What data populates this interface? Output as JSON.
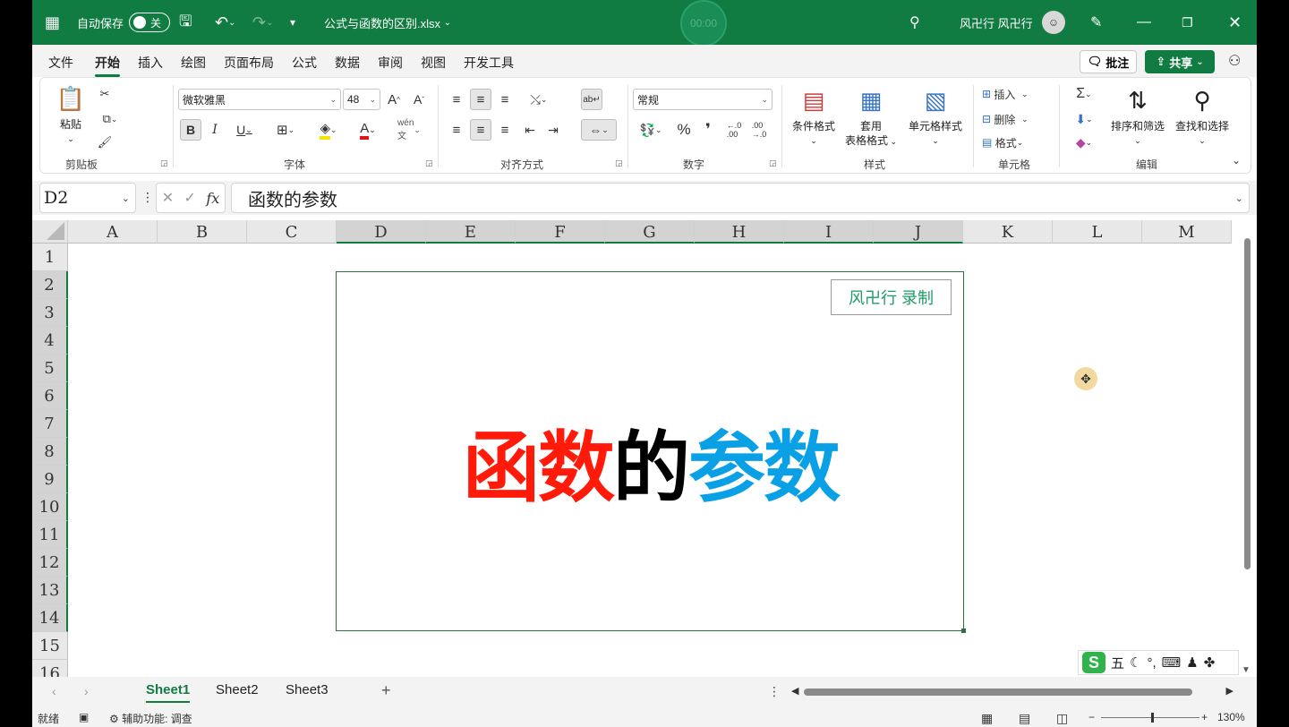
{
  "titlebar": {
    "autosave_label": "自动保存",
    "autosave_state": "关",
    "filename": "公式与函数的区别.xlsx",
    "timer": "00:00",
    "user": "风卍行 风卍行"
  },
  "tabs": [
    "文件",
    "开始",
    "插入",
    "绘图",
    "页面布局",
    "公式",
    "数据",
    "审阅",
    "视图",
    "开发工具"
  ],
  "active_tab": "开始",
  "comment_label": "批注",
  "share_label": "共享",
  "ribbon": {
    "clipboard": {
      "paste": "粘贴",
      "group": "剪贴板"
    },
    "font": {
      "name": "微软雅黑",
      "size": "48",
      "group": "字体"
    },
    "alignment": {
      "group": "对齐方式"
    },
    "number": {
      "format": "常规",
      "group": "数字"
    },
    "styles": {
      "conditional": "条件格式",
      "table_a": "套用",
      "table_b": "表格格式",
      "cell_styles": "单元格样式",
      "group": "样式"
    },
    "cells": {
      "insert": "插入",
      "delete": "删除",
      "format": "格式",
      "group": "单元格"
    },
    "editing": {
      "sort": "排序和筛选",
      "find": "查找和选择",
      "group": "编辑"
    }
  },
  "formula_bar": {
    "name_box": "D2",
    "content": "函数的参数"
  },
  "columns": [
    "A",
    "B",
    "C",
    "D",
    "E",
    "F",
    "G",
    "H",
    "I",
    "J",
    "K",
    "L",
    "M"
  ],
  "selected_columns": [
    "D",
    "E",
    "F",
    "G",
    "H",
    "I",
    "J"
  ],
  "rows": [
    "1",
    "2",
    "3",
    "4",
    "5",
    "6",
    "7",
    "8",
    "9",
    "10",
    "11",
    "12",
    "13",
    "14",
    "15",
    "16"
  ],
  "selected_rows": [
    "2",
    "3",
    "4",
    "5",
    "6",
    "7",
    "8",
    "9",
    "10",
    "11",
    "12",
    "13",
    "14"
  ],
  "shape": {
    "watermark": "风卍行 录制",
    "title_red": "函数",
    "title_black": "的",
    "title_blue": "参数",
    "colors": {
      "red": "#ff1a0a",
      "black": "#000000",
      "blue": "#0aa0e6"
    }
  },
  "ime": {
    "mode": "五"
  },
  "sheets": [
    "Sheet1",
    "Sheet2",
    "Sheet3"
  ],
  "active_sheet": "Sheet1",
  "status": {
    "ready": "就绪",
    "accessibility": "辅助功能: 调查",
    "zoom": "130%"
  },
  "accent": "#107c41"
}
